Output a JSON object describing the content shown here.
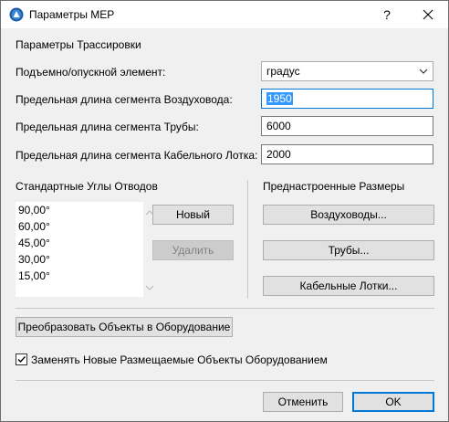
{
  "window": {
    "title": "Параметры MEP",
    "help_label": "?"
  },
  "routing": {
    "section_title": "Параметры Трассировки",
    "rise_label": "Подъемно/опускной элемент:",
    "rise_value": "градус",
    "duct_label": "Предельная длина сегмента Воздуховода:",
    "duct_value": "1950",
    "pipe_label": "Предельная длина сегмента Трубы:",
    "pipe_value": "6000",
    "cable_label": "Предельная длина сегмента Кабельного Лотка:",
    "cable_value": "2000"
  },
  "angles": {
    "section_title": "Стандартные Углы Отводов",
    "items": [
      "90,00°",
      "60,00°",
      "45,00°",
      "30,00°",
      "15,00°"
    ],
    "new_label": "Новый",
    "delete_label": "Удалить"
  },
  "presets": {
    "section_title": "Преднастроенные Размеры",
    "ducts_label": "Воздуховоды...",
    "pipes_label": "Трубы...",
    "cable_label": "Кабельные Лотки..."
  },
  "convert_label": "Преобразовать Объекты в Оборудование",
  "replace_checkbox": {
    "label": "Заменять Новые Размещаемые Объекты Оборудованием",
    "checked": true
  },
  "footer": {
    "cancel_label": "Отменить",
    "ok_label": "OK"
  }
}
